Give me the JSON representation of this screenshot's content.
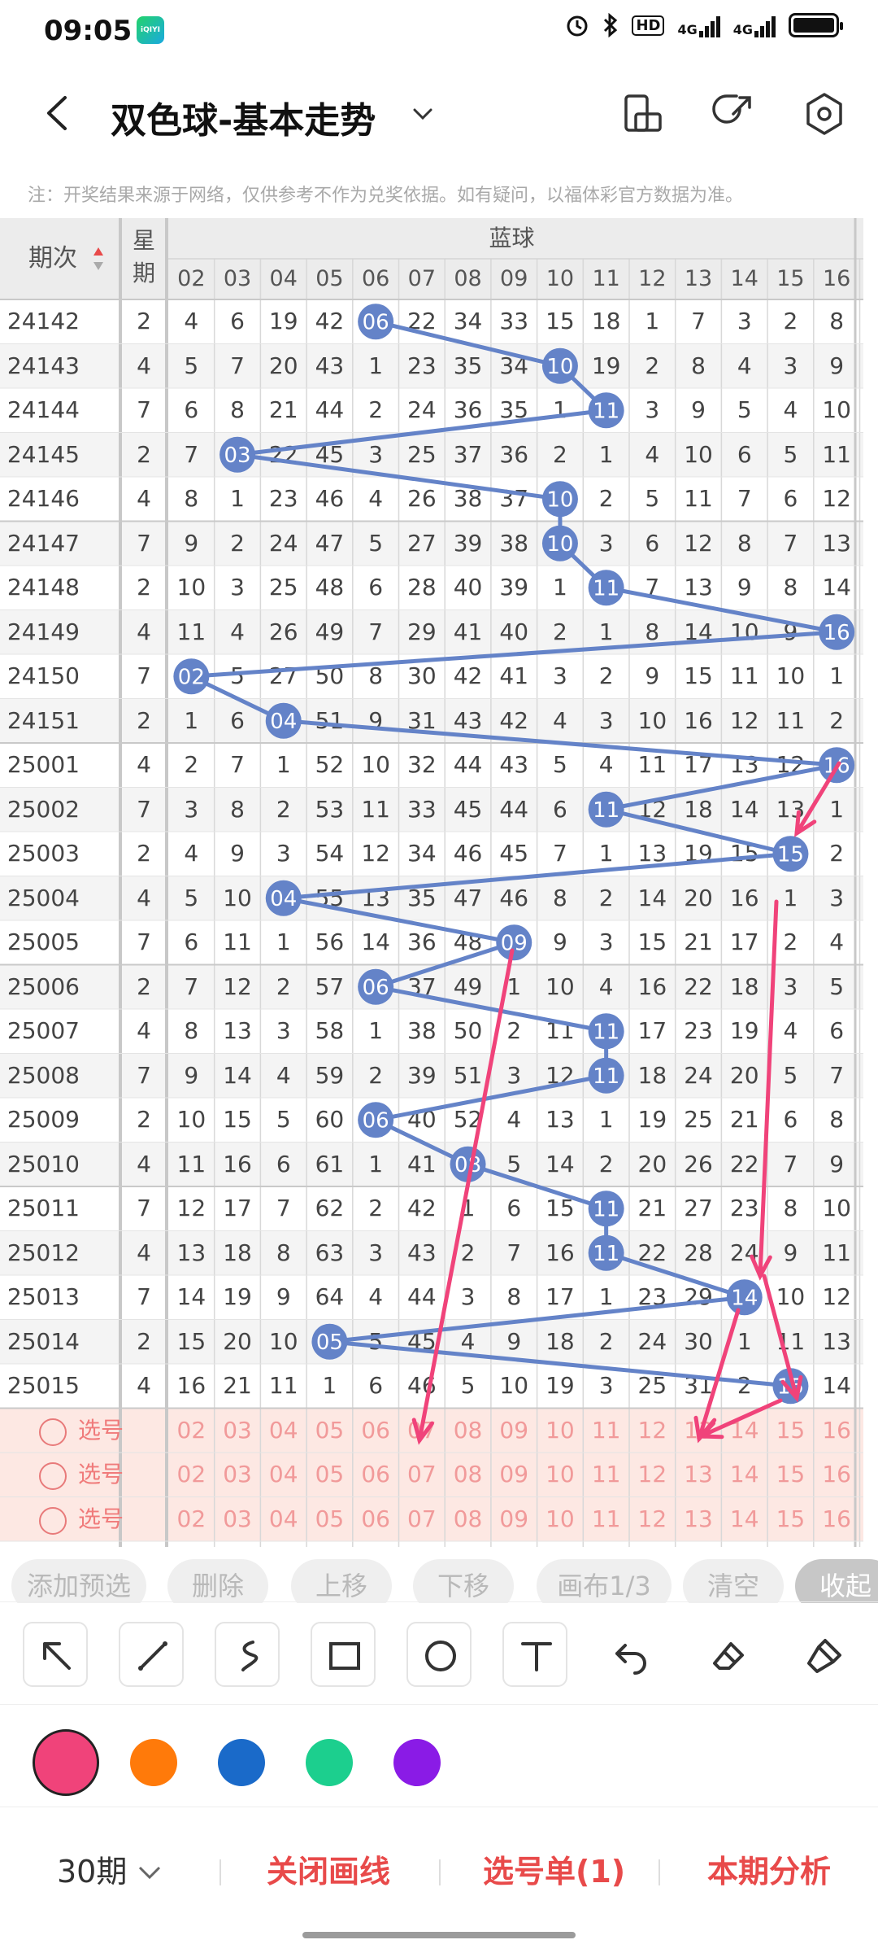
{
  "status": {
    "time": "09:05",
    "app_icon": "iQIYI",
    "hd": "HD",
    "net1": "4G",
    "net2": "4G"
  },
  "header": {
    "title": "双色球-基本走势"
  },
  "note": "注：开奖结果来源于网络，仅供参考不作为兑奖依据。如有疑问，以福体彩官方数据为准。",
  "table": {
    "col_period": "期次",
    "col_weekday": "星期",
    "blue_title": "蓝球",
    "blue_cols": [
      "02",
      "03",
      "04",
      "05",
      "06",
      "07",
      "08",
      "09",
      "10",
      "11",
      "12",
      "13",
      "14",
      "15",
      "16"
    ],
    "rows": [
      {
        "p": "24142",
        "w": "2",
        "v": [
          "4",
          "6",
          "19",
          "42",
          "06",
          "22",
          "34",
          "33",
          "15",
          "18",
          "1",
          "7",
          "3",
          "2",
          "8"
        ]
      },
      {
        "p": "24143",
        "w": "4",
        "v": [
          "5",
          "7",
          "20",
          "43",
          "1",
          "23",
          "35",
          "34",
          "10",
          "19",
          "2",
          "8",
          "4",
          "3",
          "9"
        ]
      },
      {
        "p": "24144",
        "w": "7",
        "v": [
          "6",
          "8",
          "21",
          "44",
          "2",
          "24",
          "36",
          "35",
          "1",
          "11",
          "3",
          "9",
          "5",
          "4",
          "10"
        ]
      },
      {
        "p": "24145",
        "w": "2",
        "v": [
          "7",
          "03",
          "22",
          "45",
          "3",
          "25",
          "37",
          "36",
          "2",
          "1",
          "4",
          "10",
          "6",
          "5",
          "11"
        ]
      },
      {
        "p": "24146",
        "w": "4",
        "v": [
          "8",
          "1",
          "23",
          "46",
          "4",
          "26",
          "38",
          "37",
          "10",
          "2",
          "5",
          "11",
          "7",
          "6",
          "12"
        ]
      },
      {
        "p": "24147",
        "w": "7",
        "v": [
          "9",
          "2",
          "24",
          "47",
          "5",
          "27",
          "39",
          "38",
          "10",
          "3",
          "6",
          "12",
          "8",
          "7",
          "13"
        ]
      },
      {
        "p": "24148",
        "w": "2",
        "v": [
          "10",
          "3",
          "25",
          "48",
          "6",
          "28",
          "40",
          "39",
          "1",
          "11",
          "7",
          "13",
          "9",
          "8",
          "14"
        ]
      },
      {
        "p": "24149",
        "w": "4",
        "v": [
          "11",
          "4",
          "26",
          "49",
          "7",
          "29",
          "41",
          "40",
          "2",
          "1",
          "8",
          "14",
          "10",
          "9",
          "16"
        ]
      },
      {
        "p": "24150",
        "w": "7",
        "v": [
          "02",
          "5",
          "27",
          "50",
          "8",
          "30",
          "42",
          "41",
          "3",
          "2",
          "9",
          "15",
          "11",
          "10",
          "1"
        ]
      },
      {
        "p": "24151",
        "w": "2",
        "v": [
          "1",
          "6",
          "04",
          "51",
          "9",
          "31",
          "43",
          "42",
          "4",
          "3",
          "10",
          "16",
          "12",
          "11",
          "2"
        ]
      },
      {
        "p": "25001",
        "w": "4",
        "v": [
          "2",
          "7",
          "1",
          "52",
          "10",
          "32",
          "44",
          "43",
          "5",
          "4",
          "11",
          "17",
          "13",
          "12",
          "16"
        ]
      },
      {
        "p": "25002",
        "w": "7",
        "v": [
          "3",
          "8",
          "2",
          "53",
          "11",
          "33",
          "45",
          "44",
          "6",
          "11",
          "12",
          "18",
          "14",
          "13",
          "1"
        ]
      },
      {
        "p": "25003",
        "w": "2",
        "v": [
          "4",
          "9",
          "3",
          "54",
          "12",
          "34",
          "46",
          "45",
          "7",
          "1",
          "13",
          "19",
          "15",
          "15",
          "2"
        ]
      },
      {
        "p": "25004",
        "w": "4",
        "v": [
          "5",
          "10",
          "04",
          "55",
          "13",
          "35",
          "47",
          "46",
          "8",
          "2",
          "14",
          "20",
          "16",
          "1",
          "3"
        ]
      },
      {
        "p": "25005",
        "w": "7",
        "v": [
          "6",
          "11",
          "1",
          "56",
          "14",
          "36",
          "48",
          "09",
          "9",
          "3",
          "15",
          "21",
          "17",
          "2",
          "4"
        ]
      },
      {
        "p": "25006",
        "w": "2",
        "v": [
          "7",
          "12",
          "2",
          "57",
          "06",
          "37",
          "49",
          "1",
          "10",
          "4",
          "16",
          "22",
          "18",
          "3",
          "5"
        ]
      },
      {
        "p": "25007",
        "w": "4",
        "v": [
          "8",
          "13",
          "3",
          "58",
          "1",
          "38",
          "50",
          "2",
          "11",
          "11",
          "17",
          "23",
          "19",
          "4",
          "6"
        ]
      },
      {
        "p": "25008",
        "w": "7",
        "v": [
          "9",
          "14",
          "4",
          "59",
          "2",
          "39",
          "51",
          "3",
          "12",
          "11",
          "18",
          "24",
          "20",
          "5",
          "7"
        ]
      },
      {
        "p": "25009",
        "w": "2",
        "v": [
          "10",
          "15",
          "5",
          "60",
          "06",
          "40",
          "52",
          "4",
          "13",
          "1",
          "19",
          "25",
          "21",
          "6",
          "8"
        ]
      },
      {
        "p": "25010",
        "w": "4",
        "v": [
          "11",
          "16",
          "6",
          "61",
          "1",
          "41",
          "08",
          "5",
          "14",
          "2",
          "20",
          "26",
          "22",
          "7",
          "9"
        ]
      },
      {
        "p": "25011",
        "w": "7",
        "v": [
          "12",
          "17",
          "7",
          "62",
          "2",
          "42",
          "1",
          "6",
          "15",
          "11",
          "21",
          "27",
          "23",
          "8",
          "10"
        ]
      },
      {
        "p": "25012",
        "w": "4",
        "v": [
          "13",
          "18",
          "8",
          "63",
          "3",
          "43",
          "2",
          "7",
          "16",
          "11",
          "22",
          "28",
          "24",
          "9",
          "11"
        ]
      },
      {
        "p": "25013",
        "w": "7",
        "v": [
          "14",
          "19",
          "9",
          "64",
          "4",
          "44",
          "3",
          "8",
          "17",
          "1",
          "23",
          "29",
          "14",
          "10",
          "12"
        ]
      },
      {
        "p": "25014",
        "w": "2",
        "v": [
          "15",
          "20",
          "10",
          "05",
          "5",
          "45",
          "4",
          "9",
          "18",
          "2",
          "24",
          "30",
          "1",
          "11",
          "13"
        ]
      },
      {
        "p": "25015",
        "w": "4",
        "v": [
          "16",
          "21",
          "11",
          "1",
          "6",
          "46",
          "5",
          "10",
          "19",
          "3",
          "25",
          "31",
          "2",
          "15",
          "14"
        ]
      }
    ],
    "pick_rows": [
      {
        "label": "选号"
      },
      {
        "label": "选号"
      },
      {
        "label": "选号"
      }
    ],
    "highlight_color": "#6483c8",
    "drawing_color": "#f0437a"
  },
  "actions": [
    "添加预选",
    "删除",
    "上移",
    "下移",
    "画布1/3",
    "清空",
    "收起"
  ],
  "tools": [
    "arrow-tool",
    "line-tool",
    "curve-tool",
    "rectangle-tool",
    "circle-tool",
    "text-tool",
    "undo-tool",
    "eraser-tool",
    "clear-canvas-tool"
  ],
  "colors": [
    "#f0437a",
    "#ff7a0a",
    "#1a6ac9",
    "#1ccf8e",
    "#8a1be6"
  ],
  "bottom": {
    "period": "30期",
    "close_draw": "关闭画线",
    "pick_list": "选号单(1)",
    "analysis": "本期分析"
  }
}
